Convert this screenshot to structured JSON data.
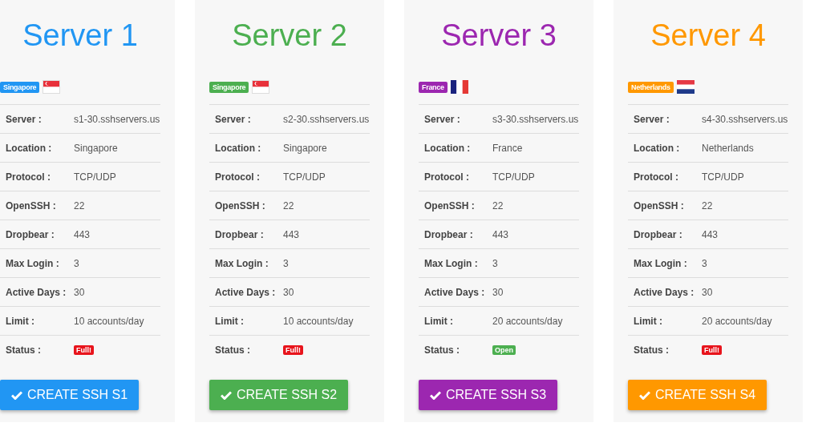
{
  "servers": [
    {
      "title": "Server 1",
      "color": "#2196f3",
      "country": "Singapore",
      "kind": "sg",
      "rows": [
        {
          "label": "Server :",
          "value": "s1-30.sshservers.us"
        },
        {
          "label": "Location :",
          "value": "Singapore"
        },
        {
          "label": "Protocol :",
          "value": "TCP/UDP"
        },
        {
          "label": "OpenSSH :",
          "value": "22"
        },
        {
          "label": "Dropbear :",
          "value": "443"
        },
        {
          "label": "Max Login :",
          "value": "3"
        },
        {
          "label": "Active Days :",
          "value": "30"
        },
        {
          "label": "Limit :",
          "value": "10 accounts/day"
        }
      ],
      "status_label": "Status :",
      "status": {
        "text": "Full!",
        "kind": "full"
      },
      "button": "CREATE SSH S1"
    },
    {
      "title": "Server 2",
      "color": "#4caf50",
      "country": "Singapore",
      "kind": "sg",
      "rows": [
        {
          "label": "Server :",
          "value": "s2-30.sshservers.us"
        },
        {
          "label": "Location :",
          "value": "Singapore"
        },
        {
          "label": "Protocol :",
          "value": "TCP/UDP"
        },
        {
          "label": "OpenSSH :",
          "value": "22"
        },
        {
          "label": "Dropbear :",
          "value": "443"
        },
        {
          "label": "Max Login :",
          "value": "3"
        },
        {
          "label": "Active Days :",
          "value": "30"
        },
        {
          "label": "Limit :",
          "value": "10 accounts/day"
        }
      ],
      "status_label": "Status :",
      "status": {
        "text": "Full!",
        "kind": "full"
      },
      "button": "CREATE SSH S2"
    },
    {
      "title": "Server 3",
      "color": "#9c27b0",
      "country": "France",
      "kind": "fr",
      "rows": [
        {
          "label": "Server :",
          "value": "s3-30.sshservers.us"
        },
        {
          "label": "Location :",
          "value": "France"
        },
        {
          "label": "Protocol :",
          "value": "TCP/UDP"
        },
        {
          "label": "OpenSSH :",
          "value": "22"
        },
        {
          "label": "Dropbear :",
          "value": "443"
        },
        {
          "label": "Max Login :",
          "value": "3"
        },
        {
          "label": "Active Days :",
          "value": "30"
        },
        {
          "label": "Limit :",
          "value": "20 accounts/day"
        }
      ],
      "status_label": "Status :",
      "status": {
        "text": "Open",
        "kind": "open"
      },
      "button": "CREATE SSH S3"
    },
    {
      "title": "Server 4",
      "color": "#ff9800",
      "country": "Netherlands",
      "kind": "nl",
      "rows": [
        {
          "label": "Server :",
          "value": "s4-30.sshservers.us"
        },
        {
          "label": "Location :",
          "value": "Netherlands"
        },
        {
          "label": "Protocol :",
          "value": "TCP/UDP"
        },
        {
          "label": "OpenSSH :",
          "value": "22"
        },
        {
          "label": "Dropbear :",
          "value": "443"
        },
        {
          "label": "Max Login :",
          "value": "3"
        },
        {
          "label": "Active Days :",
          "value": "30"
        },
        {
          "label": "Limit :",
          "value": "20 accounts/day"
        }
      ],
      "status_label": "Status :",
      "status": {
        "text": "Full!",
        "kind": "full"
      },
      "button": "CREATE SSH S4"
    }
  ]
}
